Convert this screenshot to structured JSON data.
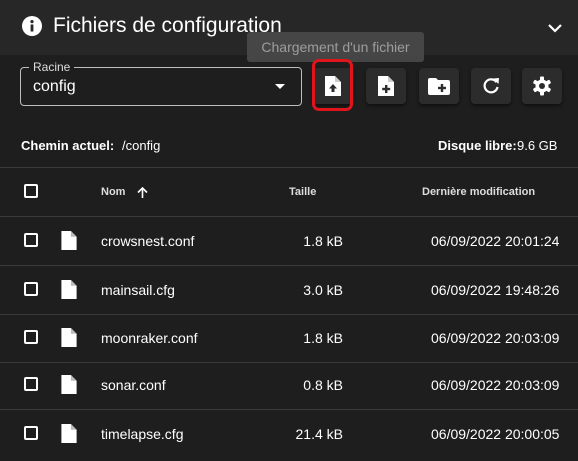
{
  "header": {
    "title": "Fichiers de configuration"
  },
  "tooltip": "Chargement d'un fichier",
  "root": {
    "label": "Racine",
    "value": "config"
  },
  "toolbar": [
    "upload-file",
    "create-file",
    "create-folder",
    "refresh",
    "settings"
  ],
  "status": {
    "path_label": "Chemin actuel:",
    "path_value": "/config",
    "disk_label": "Disque libre:",
    "disk_value": "9.6 GB"
  },
  "table": {
    "columns": {
      "name": "Nom",
      "size": "Taille",
      "modified": "Dernière modification"
    },
    "sort_icon": "arrow-up-icon",
    "rows": [
      {
        "name": "crowsnest.conf",
        "size": "1.8 kB",
        "modified": "06/09/2022 20:01:24"
      },
      {
        "name": "mainsail.cfg",
        "size": "3.0 kB",
        "modified": "06/09/2022 19:48:26"
      },
      {
        "name": "moonraker.conf",
        "size": "1.8 kB",
        "modified": "06/09/2022 20:03:09"
      },
      {
        "name": "sonar.conf",
        "size": "0.8 kB",
        "modified": "06/09/2022 20:03:09"
      },
      {
        "name": "timelapse.cfg",
        "size": "21.4 kB",
        "modified": "06/09/2022 20:00:05"
      }
    ]
  },
  "colors": {
    "background": "#1e1e1e",
    "header": "#272727",
    "button": "#2c2c2c",
    "highlight": "#e0141b"
  }
}
